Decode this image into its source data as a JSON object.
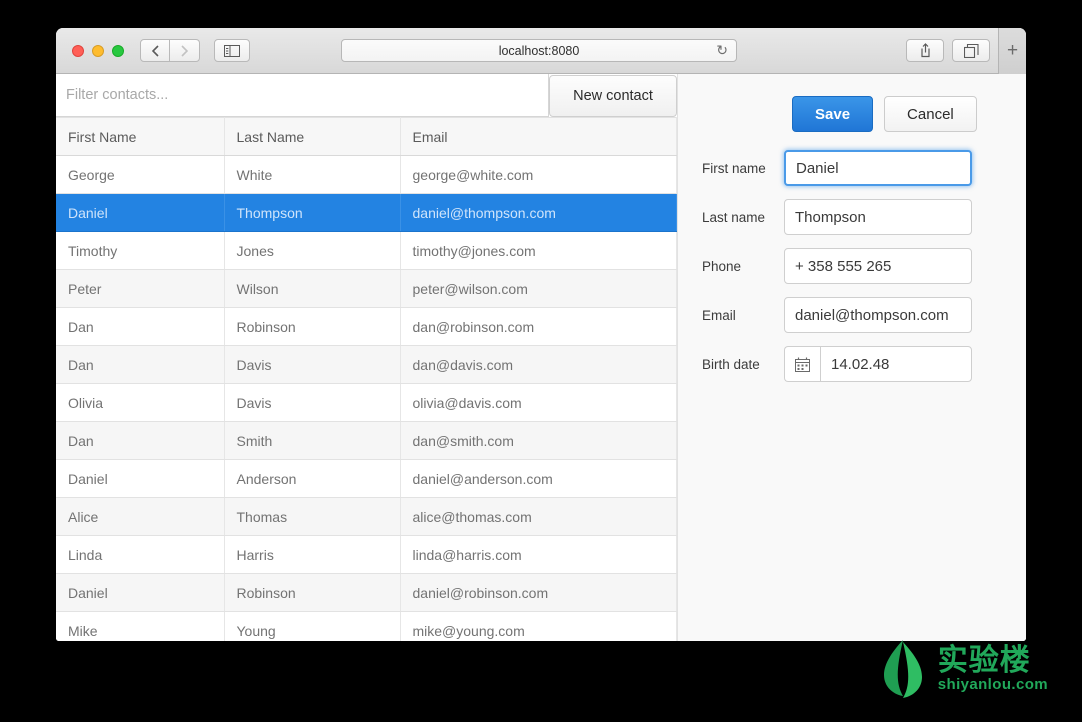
{
  "browser": {
    "url": "localhost:8080",
    "reload_icon": "reload-icon",
    "back_icon": "‹",
    "forward_icon": "›",
    "sidebar_icon": "sidebar-icon",
    "share_icon": "share-icon",
    "tabs_icon": "tabs-icon",
    "new_tab_icon": "+"
  },
  "app": {
    "filter": {
      "placeholder": "Filter contacts...",
      "value": ""
    },
    "new_contact_label": "New contact",
    "table": {
      "columns": [
        "First Name",
        "Last Name",
        "Email"
      ],
      "rows": [
        {
          "first": "George",
          "last": "White",
          "email": "george@white.com"
        },
        {
          "first": "Daniel",
          "last": "Thompson",
          "email": "daniel@thompson.com"
        },
        {
          "first": "Timothy",
          "last": "Jones",
          "email": "timothy@jones.com"
        },
        {
          "first": "Peter",
          "last": "Wilson",
          "email": "peter@wilson.com"
        },
        {
          "first": "Dan",
          "last": "Robinson",
          "email": "dan@robinson.com"
        },
        {
          "first": "Dan",
          "last": "Davis",
          "email": "dan@davis.com"
        },
        {
          "first": "Olivia",
          "last": "Davis",
          "email": "olivia@davis.com"
        },
        {
          "first": "Dan",
          "last": "Smith",
          "email": "dan@smith.com"
        },
        {
          "first": "Daniel",
          "last": "Anderson",
          "email": "daniel@anderson.com"
        },
        {
          "first": "Alice",
          "last": "Thomas",
          "email": "alice@thomas.com"
        },
        {
          "first": "Linda",
          "last": "Harris",
          "email": "linda@harris.com"
        },
        {
          "first": "Daniel",
          "last": "Robinson",
          "email": "daniel@robinson.com"
        },
        {
          "first": "Mike",
          "last": "Young",
          "email": "mike@young.com"
        }
      ],
      "selected_index": 1
    },
    "form": {
      "save_label": "Save",
      "cancel_label": "Cancel",
      "fields": [
        {
          "label": "First name",
          "value": "Daniel",
          "focused": true
        },
        {
          "label": "Last name",
          "value": "Thompson",
          "focused": false
        },
        {
          "label": "Phone",
          "value": "+ 358 555 265",
          "focused": false
        },
        {
          "label": "Email",
          "value": "daniel@thompson.com",
          "focused": false
        }
      ],
      "birth_date": {
        "label": "Birth date",
        "value": "14.02.48",
        "addon_icon": "calendar-icon"
      }
    }
  },
  "watermark": {
    "cn": "实验楼",
    "en": "shiyanlou.com",
    "color": "#21a85a"
  },
  "colors": {
    "accent": "#2383e2",
    "primary_button": "#2076d6",
    "selected_row": "#2383e2",
    "panel_bg": "#f9f9f9"
  }
}
